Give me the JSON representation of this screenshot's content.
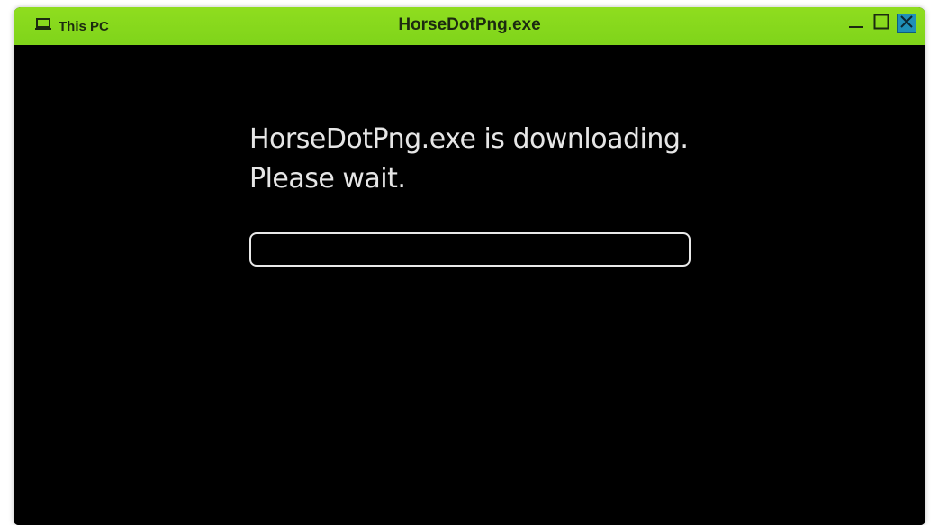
{
  "window": {
    "title": "HorseDotPng.exe",
    "location_label": "This PC",
    "controls": {
      "minimize": "minimize",
      "maximize": "maximize",
      "close": "close"
    }
  },
  "content": {
    "message_line1": "HorseDotPng.exe is downloading.",
    "message_line2": "Please wait.",
    "progress": 0
  },
  "icons": {
    "location": "laptop-icon",
    "minimize": "minimize-icon",
    "maximize": "maximize-icon",
    "close": "close-icon"
  },
  "colors": {
    "titlebar": "#8fdd1f",
    "background": "#000000",
    "text": "#e6e6e6",
    "close_button": "#1f8fb8",
    "progress_border": "#e9e9e9"
  }
}
